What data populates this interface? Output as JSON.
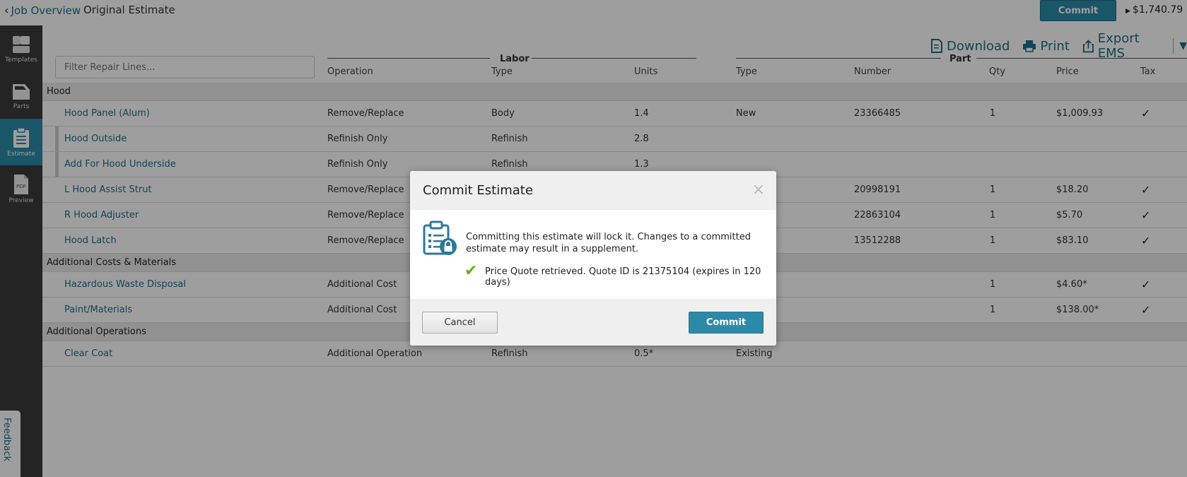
{
  "topbar": {
    "back_label": "Job Overview",
    "title": "Original Estimate",
    "commit_label": "Commit",
    "total": "$1,740.79"
  },
  "sidebar": {
    "items": [
      {
        "label": "Templates",
        "icon": "templates-icon"
      },
      {
        "label": "Parts",
        "icon": "parts-icon"
      },
      {
        "label": "Estimate",
        "icon": "estimate-icon"
      },
      {
        "label": "Preview",
        "icon": "pdf-icon",
        "icon_text": "PDF"
      }
    ],
    "feedback": "Feedback"
  },
  "toolbar": {
    "download": "Download",
    "print": "Print",
    "export": "Export EMS"
  },
  "filter": {
    "placeholder": "Filter Repair Lines..."
  },
  "groups": {
    "labor": "Labor",
    "part": "Part"
  },
  "columns": {
    "operation": "Operation",
    "labor_type": "Type",
    "units": "Units",
    "part_type": "Type",
    "number": "Number",
    "qty": "Qty",
    "price": "Price",
    "tax": "Tax"
  },
  "rows": [
    {
      "section": "Hood"
    },
    {
      "name": "Hood Panel (Alum)",
      "operation": "Remove/Replace",
      "labor_type": "Body",
      "units": "1.4",
      "part_type": "New",
      "number": "23366485",
      "qty": "1",
      "price": "$1,009.93",
      "tax": "✓"
    },
    {
      "name": "Hood Outside",
      "operation": "Refinish Only",
      "labor_type": "Refinish",
      "units": "2.8",
      "sub": true
    },
    {
      "name": "Add For Hood Underside",
      "operation": "Refinish Only",
      "labor_type": "Refinish",
      "units": "1.3",
      "sub": true
    },
    {
      "name": "L Hood Assist Strut",
      "operation": "Remove/Replace",
      "number": "20998191",
      "qty": "1",
      "price": "$18.20",
      "tax": "✓"
    },
    {
      "name": "R Hood Adjuster",
      "operation": "Remove/Replace",
      "number": "22863104",
      "qty": "1",
      "price": "$5.70",
      "tax": "✓"
    },
    {
      "name": "Hood Latch",
      "operation": "Remove/Replace",
      "number": "13512288",
      "qty": "1",
      "price": "$83.10",
      "tax": "✓"
    },
    {
      "section": "Additional Costs & Materials"
    },
    {
      "name": "Hazardous Waste Disposal",
      "operation": "Additional Cost",
      "qty": "1",
      "price": "$4.60*",
      "tax": "✓"
    },
    {
      "name": "Paint/Materials",
      "operation": "Additional Cost",
      "qty": "1",
      "price": "$138.00*",
      "tax": "✓"
    },
    {
      "section": "Additional Operations"
    },
    {
      "name": "Clear Coat",
      "operation": "Additional Operation",
      "labor_type": "Refinish",
      "units": "0.5*",
      "part_type": "Existing"
    }
  ],
  "modal": {
    "title": "Commit Estimate",
    "close": "×",
    "message": "Committing this estimate will lock it. Changes to a committed estimate may result in a supplement.",
    "quote": "Price Quote retrieved. Quote ID is 21375104 (expires in 120 days)",
    "cancel": "Cancel",
    "commit": "Commit"
  },
  "colors": {
    "accent": "#2c8aa8",
    "link": "#1e6f8a",
    "sidebar": "#3a3a3a",
    "success": "#6aab22"
  }
}
